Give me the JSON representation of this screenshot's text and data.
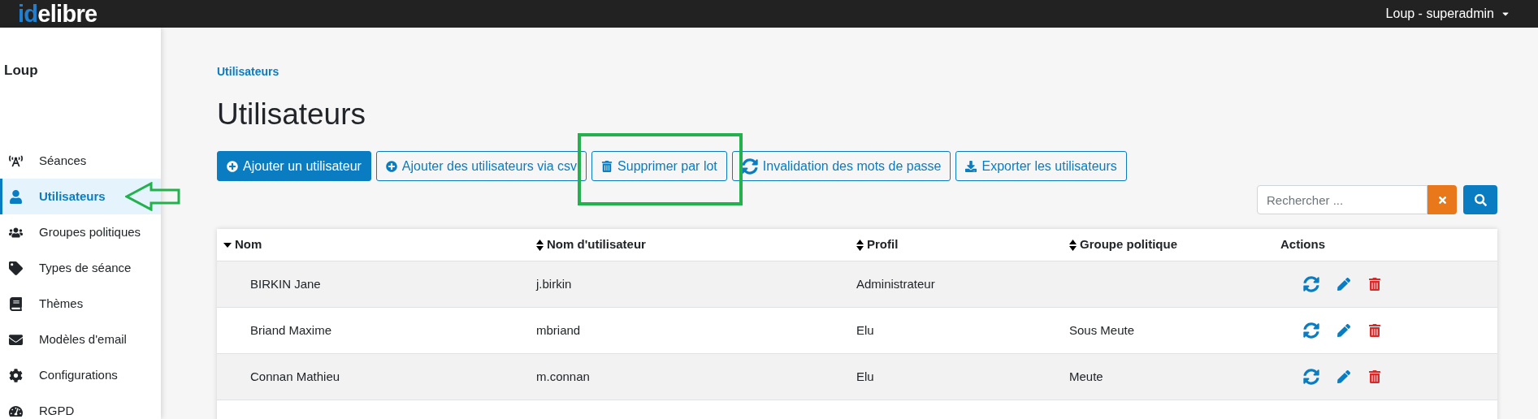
{
  "topbar": {
    "logo": {
      "prefix": "id",
      "suffix": "elibre"
    },
    "user_menu": "Loup - superadmin"
  },
  "sidebar": {
    "title": "Loup",
    "items": [
      {
        "label": "Séances",
        "kind": "seances",
        "selected": false
      },
      {
        "label": "Utilisateurs",
        "kind": "user",
        "selected": true,
        "annotated": true
      },
      {
        "label": "Groupes politiques",
        "kind": "users",
        "selected": false
      },
      {
        "label": "Types de séance",
        "kind": "tag",
        "selected": false
      },
      {
        "label": "Thèmes",
        "kind": "book",
        "selected": false
      },
      {
        "label": "Modèles d'email",
        "kind": "mail",
        "selected": false
      },
      {
        "label": "Configurations",
        "kind": "cog",
        "selected": false
      },
      {
        "label": "RGPD",
        "kind": "gauge",
        "selected": false
      }
    ]
  },
  "breadcrumb": "Utilisateurs",
  "page_title": "Utilisateurs",
  "toolbar": [
    {
      "label": "Ajouter un utilisateur",
      "kind": "add",
      "primary": true
    },
    {
      "label": "Ajouter des utilisateurs via csv",
      "kind": "add",
      "primary": false
    },
    {
      "label": "Supprimer par lot",
      "kind": "delete",
      "primary": false,
      "annotated": true
    },
    {
      "label": "Invalidation des mots de passe",
      "kind": "sync",
      "primary": false
    },
    {
      "label": "Exporter les utilisateurs",
      "kind": "export",
      "primary": false
    }
  ],
  "search": {
    "placeholder": "Rechercher ..."
  },
  "table": {
    "columns": [
      {
        "label": "Nom",
        "sortable": true,
        "sorted": true
      },
      {
        "label": "Nom d'utilisateur",
        "sortable": true,
        "sorted": false
      },
      {
        "label": "Profil",
        "sortable": true,
        "sorted": false
      },
      {
        "label": "Groupe politique",
        "sortable": true,
        "sorted": false
      },
      {
        "label": "Actions",
        "sortable": false
      }
    ],
    "rows": [
      {
        "name": "BIRKIN Jane",
        "username": "j.birkin",
        "profile": "Administrateur"
      },
      {
        "name": "Briand Maxime",
        "username": "mbriand",
        "profile": "Elu",
        "group": "Sous Meute"
      },
      {
        "name": "Connan Mathieu",
        "username": "m.connan",
        "profile": "Elu",
        "group": "Meute"
      }
    ]
  }
}
